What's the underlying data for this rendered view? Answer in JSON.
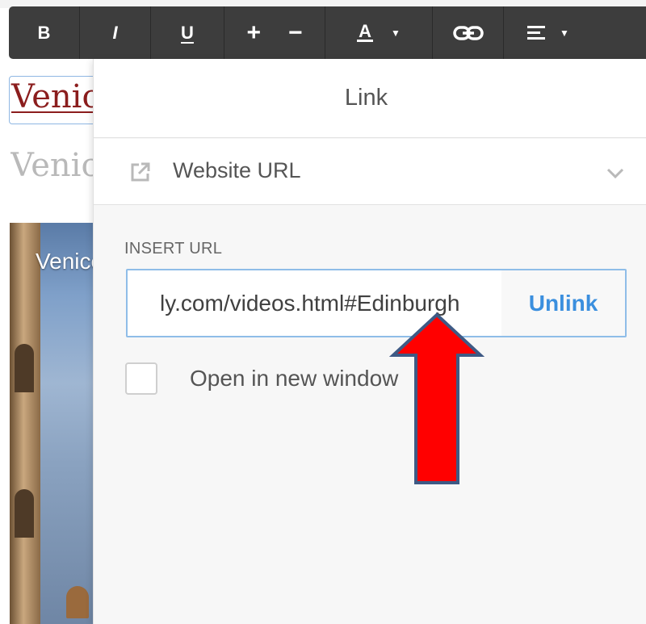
{
  "toolbar": {
    "bold": "B",
    "italic": "I",
    "underline": "U",
    "increase": "+",
    "decrease": "−",
    "text_color": "A",
    "caret": "▼"
  },
  "background": {
    "heading1": "Venice",
    "heading2": "Venice",
    "image_caption": "Venice",
    "heading1_color": "#8b1d1d"
  },
  "link_panel": {
    "title": "Link",
    "type_icon": "external-link-icon",
    "type_label": "Website URL",
    "url_label": "INSERT URL",
    "url_value": "ly.com/videos.html#Edinburgh",
    "unlink_label": "Unlink",
    "open_new_window_label": "Open in new window",
    "open_new_window_checked": false,
    "accent_color": "#3b8fde"
  },
  "annotation": {
    "arrow_color": "#ff0000"
  }
}
